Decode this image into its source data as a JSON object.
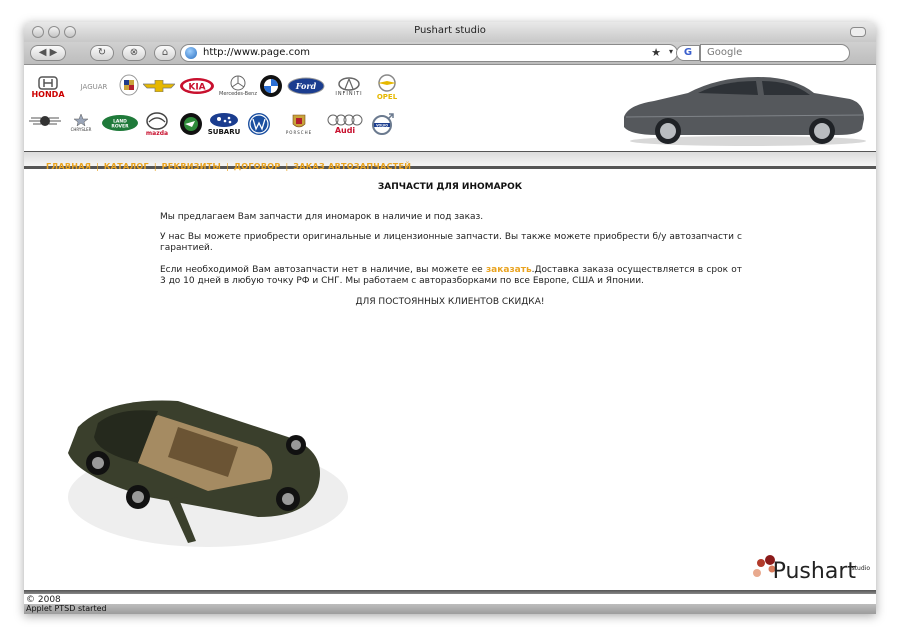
{
  "window": {
    "title": "Pushart studio"
  },
  "toolbar": {
    "url": "http://www.page.com",
    "search_placeholder": "Google",
    "search_engine_icon": "G"
  },
  "brands": {
    "honda": "HONDA",
    "jaguar": "JAGUAR",
    "kia": "KIA",
    "mercedes": "Mercedes-Benz",
    "ford": "Ford",
    "infiniti": "INFINITI",
    "opel": "OPEL",
    "chrysler": "CHRYSLER",
    "landrover": "LAND ROVER",
    "mazda": "mazda",
    "subaru": "SUBARU",
    "porsche": "PORSCHE",
    "audi": "Audi",
    "volvo": "VOLVO"
  },
  "nav": {
    "items": [
      "ГЛАВНАЯ",
      "КАТАЛОГ",
      "РЕКВИЗИТЫ",
      "ДОГОВОР",
      "ЗАКАЗ АВТОЗАПЧАСТЕЙ"
    ],
    "separator": "|"
  },
  "content": {
    "title": "ЗАПЧАСТИ ДЛЯ ИНОМАРОК",
    "p1": "Мы предлагаем Вам запчасти для иномарок в наличие и под заказ.",
    "p2": "У нас Вы можете приобрести оригинальные и лицензионные запчасти. Вы также можете приобрести б/у автозапчасти с гарантией.",
    "p3_before": "Если необходимой Вам автозапчасти нет в наличие, вы можете ее ",
    "p3_link": "заказать",
    "p3_after": ".Доставка заказа осуществляется в срок от 3 до 10 дней в любую точку РФ и СНГ. Мы работаем с авторазборками по все Европе, США и Японии.",
    "discount": "ДЛЯ ПОСТОЯННЫХ КЛИЕНТОВ СКИДКА!"
  },
  "branding": {
    "name": "Pushart",
    "sup": "studio"
  },
  "footer": {
    "copyright": "© 2008",
    "status": "Applet PTSD started"
  },
  "colors": {
    "accent": "#e9a320"
  }
}
